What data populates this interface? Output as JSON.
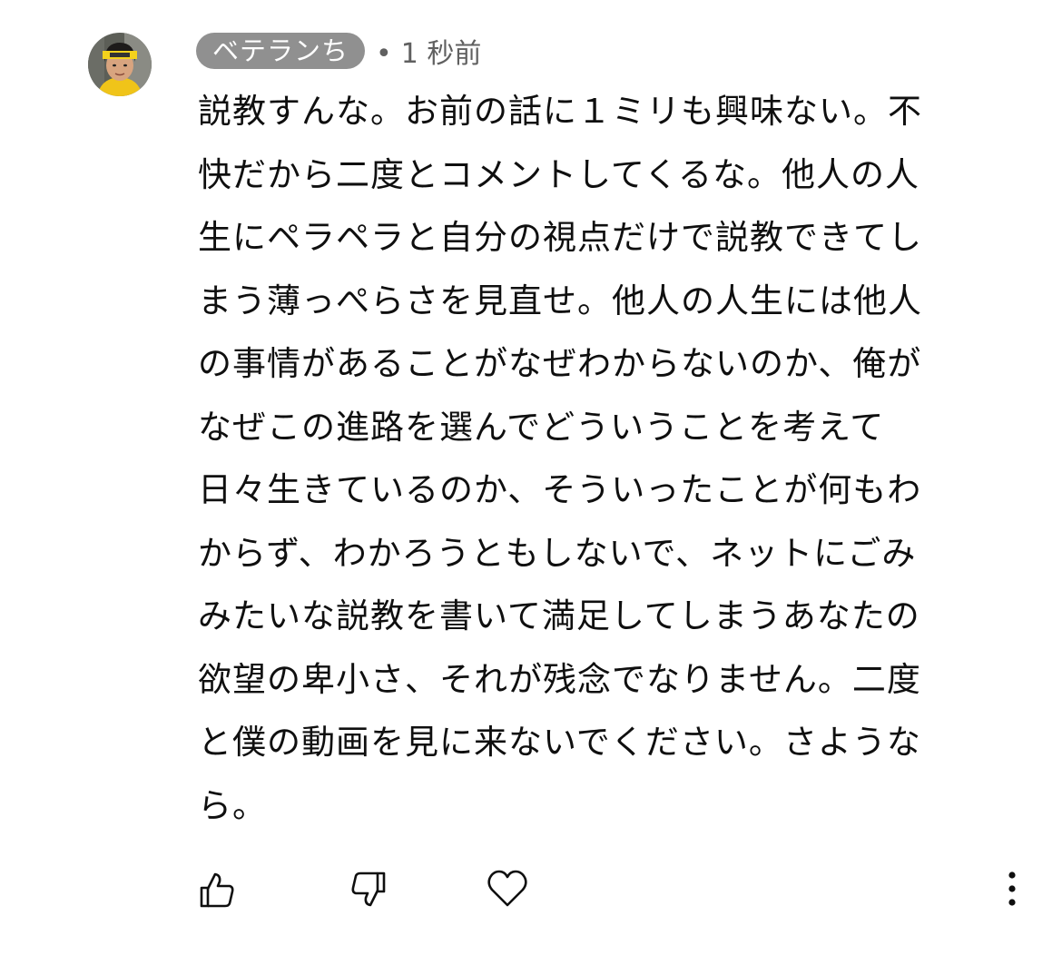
{
  "comment": {
    "author": "ベテランち",
    "separator": "•",
    "time": "1 秒前",
    "lines": [
      "説教すんな。お前の話に１ミリも興味ない。不",
      "快だから二度とコメントしてくるな。他人の人",
      "生にペラペラと自分の視点だけで説教できてし",
      "まう薄っぺらさを見直せ。他人の人生には他人",
      "の事情があることがなぜわからないのか、俺が",
      "なぜこの進路を選んでどういうことを考えて",
      "日々生きているのか、そういったことが何もわ",
      "からず、わかろうともしないで、ネットにごみ",
      "みたいな説教を書いて満足してしまうあなたの",
      "欲望の卑小さ、それが残念でなりません。二度",
      "と僕の動画を見に来ないでください。さような",
      "ら。"
    ]
  },
  "actions": {
    "like_icon": "thumbs-up-icon",
    "dislike_icon": "thumbs-down-icon",
    "heart_icon": "heart-icon",
    "more_icon": "more-vertical-icon"
  },
  "colors": {
    "author_chip_bg": "#909090",
    "meta_text": "#606060",
    "body_text": "#0f0f0f",
    "icon_stroke": "#0f0f0f"
  }
}
